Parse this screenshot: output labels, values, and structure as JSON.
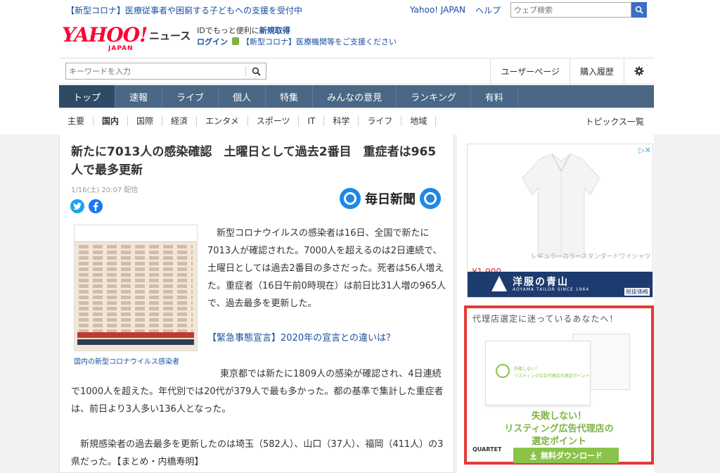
{
  "topbar": {
    "news_link": "【新型コロナ】医療従事者や困窮する子どもへの支援を受付中",
    "yahoo_japan": "Yahoo! JAPAN",
    "help": "ヘルプ",
    "web_search_placeholder": "ウェブ検索"
  },
  "header": {
    "logo_text": "YAHOO!",
    "logo_japan": "JAPAN",
    "news_label": "ニュース",
    "id_promo_prefix": "IDでもっと便利に",
    "id_promo_link": "新規取得",
    "login": "ログイン",
    "covid_support": "【新型コロナ】医療機関等をご支援ください"
  },
  "search": {
    "placeholder": "キーワードを入力",
    "user_page": "ユーザーページ",
    "purchase_history": "購入履歴"
  },
  "main_nav": [
    "トップ",
    "速報",
    "ライブ",
    "個人",
    "特集",
    "みんなの意見",
    "ランキング",
    "有料"
  ],
  "sub_nav": [
    "主要",
    "国内",
    "国際",
    "経済",
    "エンタメ",
    "スポーツ",
    "IT",
    "科学",
    "ライフ",
    "地域"
  ],
  "topics_list": "トピックス一覧",
  "article": {
    "headline": "新たに7013人の感染確認　土曜日として過去2番目　重症者は965人で最多更新",
    "date": "1/16(土) 20:07 配信",
    "publisher": "毎日新聞",
    "figure_caption": "国内の新型コロナウイルス感染者",
    "p1": "新型コロナウイルスの感染者は16日、全国で新たに7013人が確認された。7000人を超えるのは2日連続で、土曜日としては過去2番目の多さだった。死者は56人増えた。重症者（16日午前0時現在）は前日比31人増の965人で、過去最多を更新した。",
    "related_link": "【緊急事態宣言】2020年の宣言との違いは？",
    "p2": "東京都では新たに1809人の感染が確認され、4日連続で1000人を超えた。年代別では20代が379人で最も多かった。都の基準で集計した重症者は、前日より3人多い136人となった。",
    "p3": "新規感染者の過去最多を更新したのは埼玉（582人）、山口（37人）、福岡（411人）の3県だった。【まとめ・内橋寿明】"
  },
  "ads": {
    "ad1": {
      "product": "レギュラーカラースタンダードワイシャツ",
      "price": "¥1,900",
      "brand": "洋服の青山",
      "brand_sub": "AOYAMA TAILOR SINCE 1964",
      "tag": "税抜価格"
    },
    "ad2": {
      "top": "代理店選定に迷っているあなたへ！",
      "card_line1": "失敗しない！",
      "card_line2": "リスティング広告代理店の選定ポイント",
      "main1": "失敗しない！",
      "main2": "リスティング広告代理店の",
      "main3": "選定ポイント",
      "company": "QUARTET",
      "download": "無料ダウンロード"
    }
  }
}
